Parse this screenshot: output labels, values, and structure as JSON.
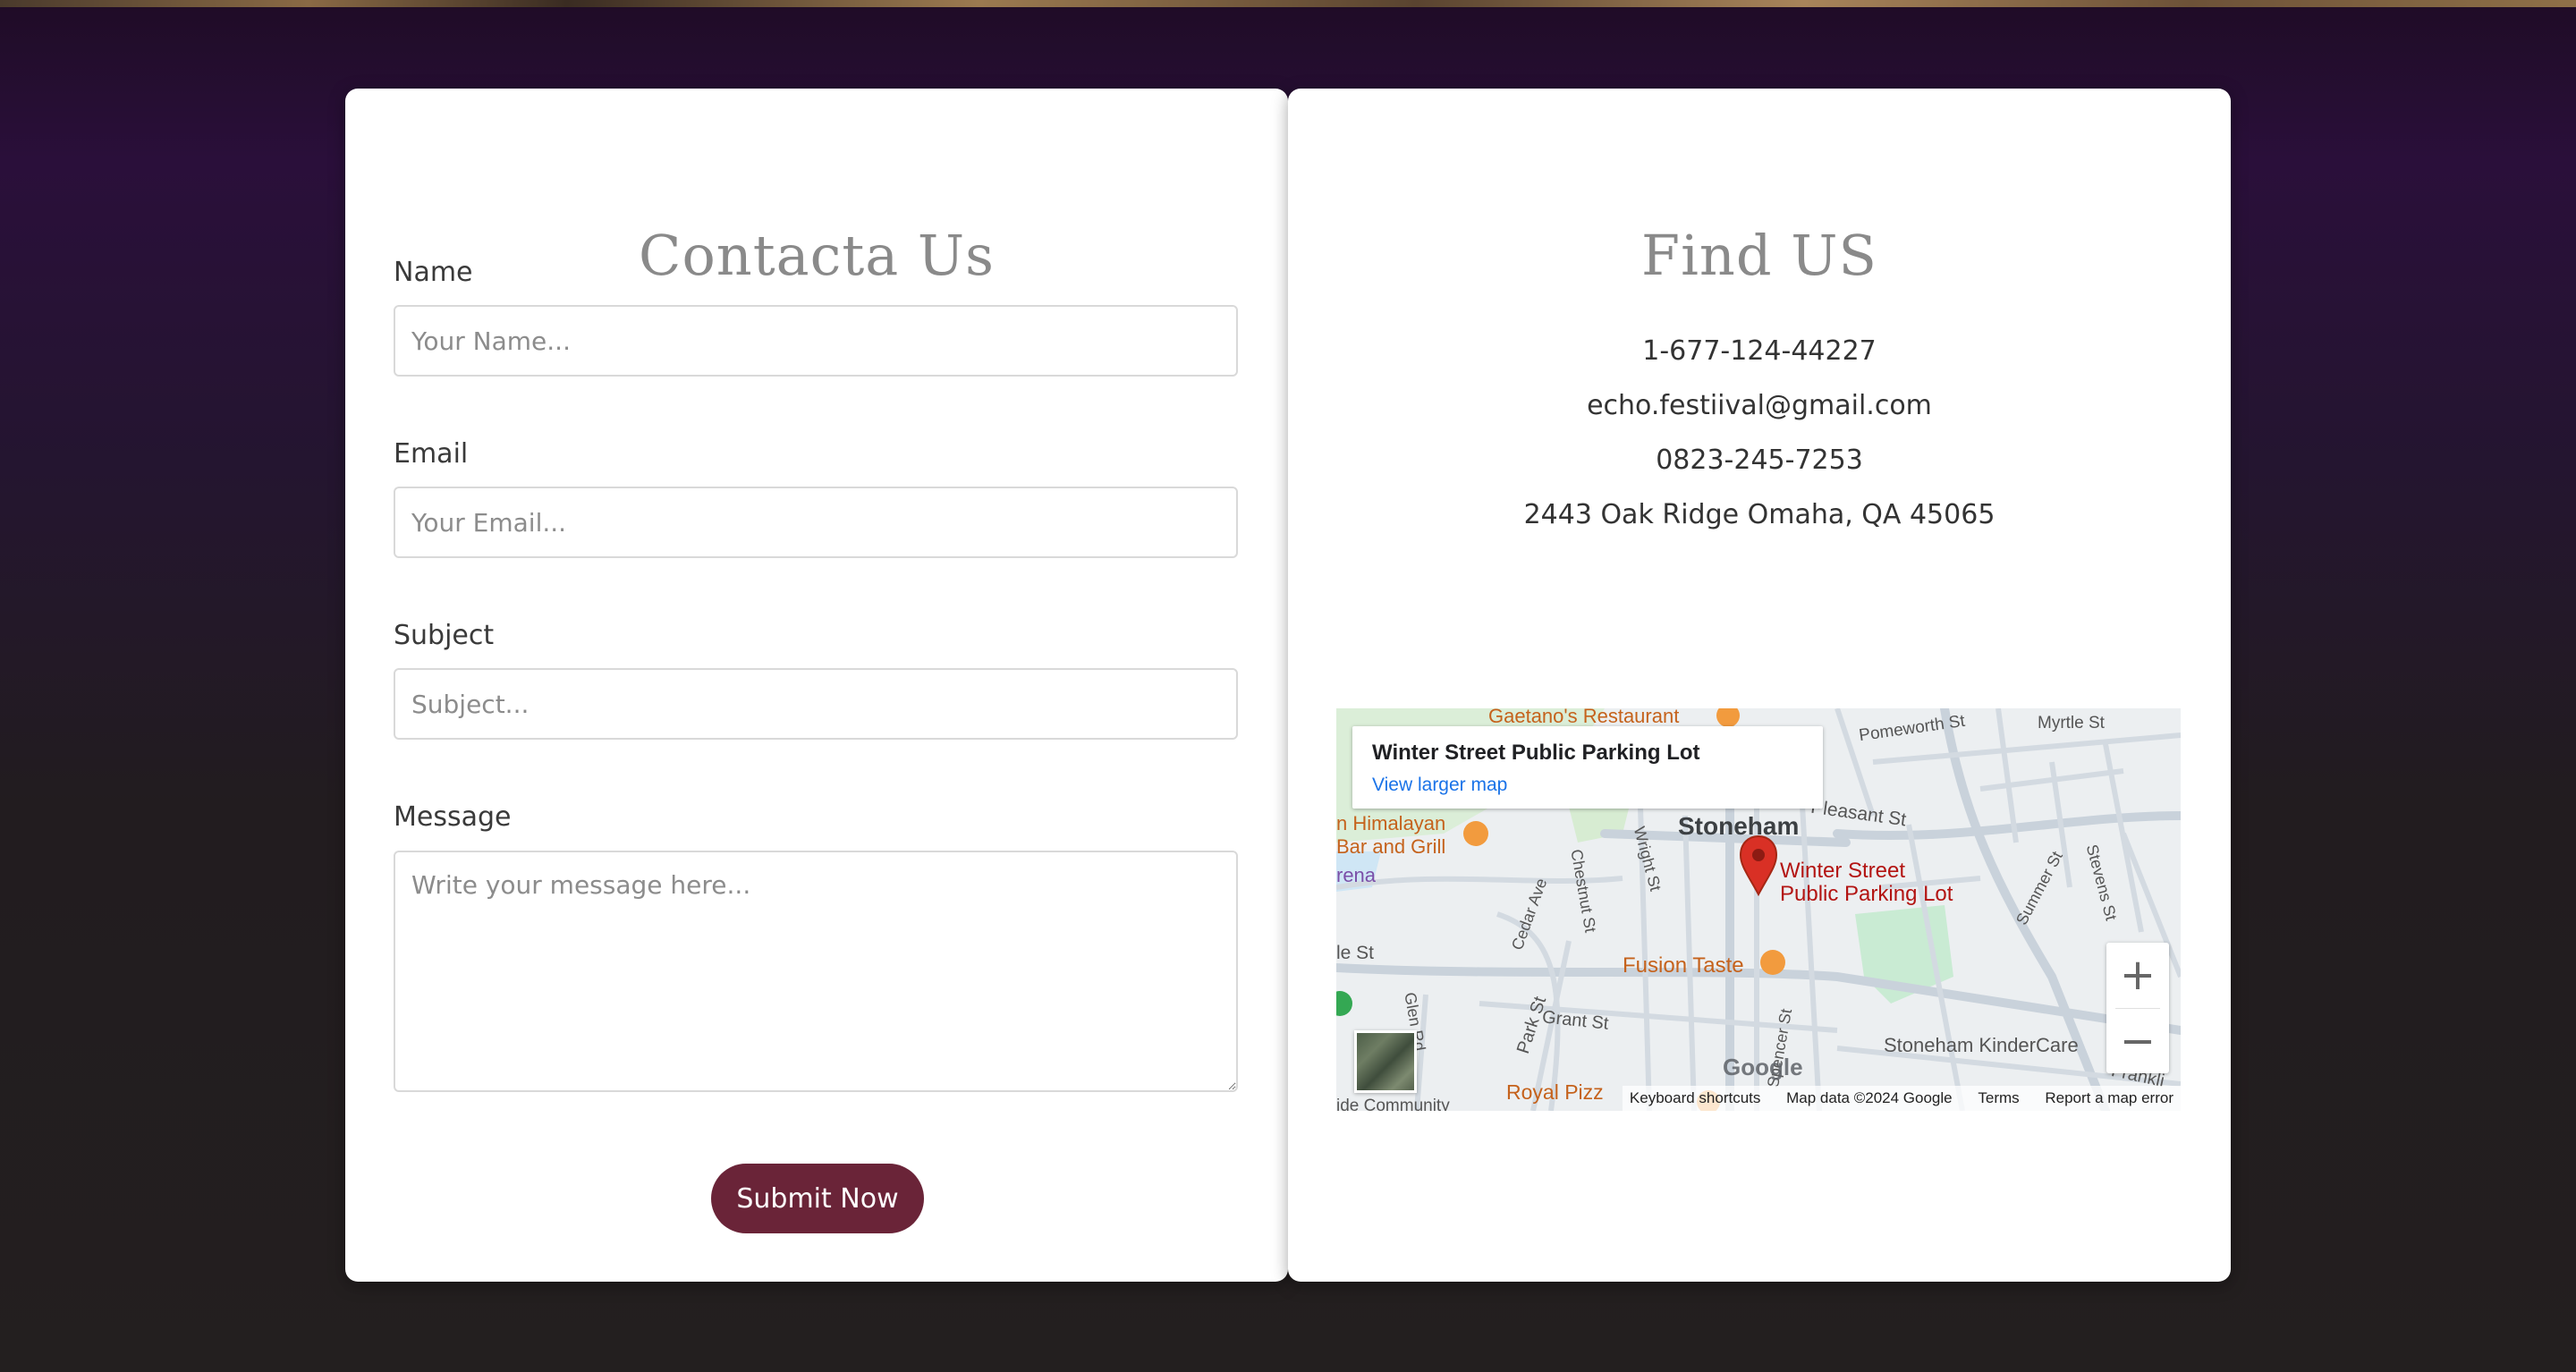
{
  "contact_form": {
    "title": "Contacta Us",
    "name_label": "Name",
    "name_placeholder": "Your Name...",
    "email_label": "Email",
    "email_placeholder": "Your Email...",
    "subject_label": "Subject",
    "subject_placeholder": "Subject...",
    "message_label": "Message",
    "message_placeholder": "Write your message here...",
    "submit_label": "Submit Now",
    "submit_color": "#6a2438"
  },
  "find_us": {
    "title": "Find US",
    "phone_1": "1-677-124-44227",
    "email": "echo.festiival@gmail.com",
    "phone_2": "0823-245-7253",
    "address": "2443 Oak Ridge Omaha, QA 45065"
  },
  "map": {
    "place_title": "Winter Street Public Parking Lot",
    "view_larger": "View larger map",
    "zoom_in": "+",
    "zoom_out": "−",
    "keyboard_shortcuts": "Keyboard shortcuts",
    "map_data": "Map data ©2024 Google",
    "terms": "Terms",
    "report": "Report a map error",
    "google": "Google",
    "labels": {
      "gaetanos": "Gaetano's Restaurant",
      "pomeworth": "Pomeworth St",
      "myrtle": "Myrtle St",
      "stoneham": "Stoneham",
      "pleasant": "Pleasant St",
      "himalayan_1": "n Himalayan",
      "himalayan_2": "Bar and Grill",
      "arena": "rena",
      "winter_1": "Winter Street",
      "winter_2": "Public Parking Lot",
      "chestnut": "Chestnut St",
      "wright": "Wright St",
      "summer": "Summer St",
      "stevens": "Stevens St",
      "cedar": "Cedar Ave",
      "le_st": "le St",
      "fusion": "Fusion Taste",
      "glen": "Glen Rd",
      "park": "Park St",
      "grant": "Grant St",
      "spencer": "Spencer St",
      "kindercare": "Stoneham KinderCare",
      "franklin": "Frankli",
      "royal": "Royal Pizz",
      "community": "ide Community"
    }
  }
}
